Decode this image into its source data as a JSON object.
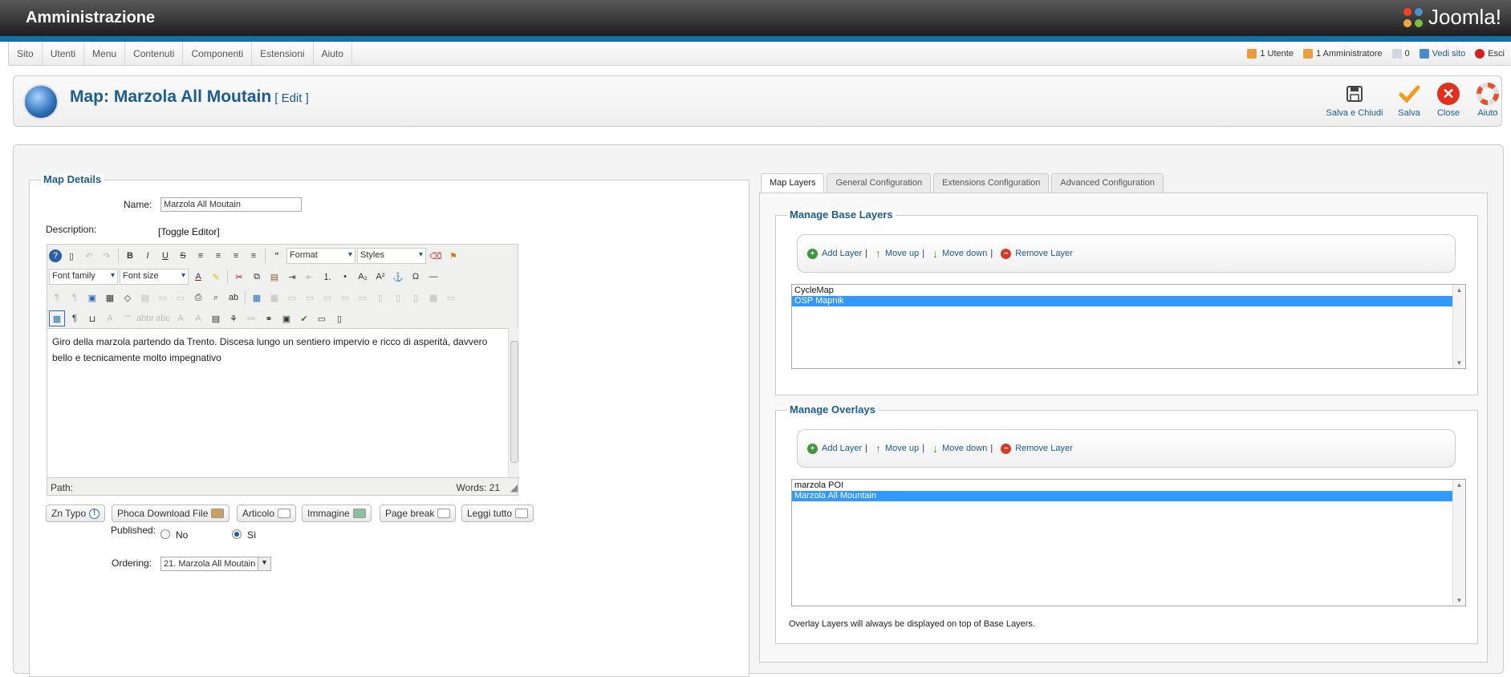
{
  "header": {
    "title": "Amministrazione",
    "logo_text": "Joomla!"
  },
  "menu": [
    "Sito",
    "Utenti",
    "Menu",
    "Contenuti",
    "Componenti",
    "Estensioni",
    "Aiuto"
  ],
  "status": {
    "users": "1 Utente",
    "admins": "1 Amministratore",
    "messages": "0",
    "view_site": "Vedi sito",
    "logout": "Esci"
  },
  "toolbar": {
    "page_title": "Map: Marzola All Moutain",
    "page_title_suffix": "[ Edit ]",
    "save_close": "Salva e Chiudi",
    "save": "Salva",
    "close": "Close",
    "help": "Aiuto"
  },
  "map_details": {
    "legend": "Map Details",
    "name_label": "Name:",
    "name_value": "Marzola All Moutain",
    "description_label": "Description:",
    "toggle_editor": "[Toggle Editor]",
    "editor": {
      "format_select": "Format",
      "styles_select": "Styles",
      "font_family_select": "Font family",
      "font_size_select": "Font size",
      "content": "Giro della marzola partendo da Trento. Discesa lungo un sentiero impervio e ricco di asperità, davvero bello e tecnicamente molto impegnativo",
      "path_label": "Path:",
      "words": "Words: 21"
    },
    "buttons": [
      "Zn Typo",
      "Phoca Download File",
      "Articolo",
      "Immagine",
      "Page break",
      "Leggi tutto"
    ],
    "published_label": "Published:",
    "published_no": "No",
    "published_yes": "Sì",
    "ordering_label": "Ordering:",
    "ordering_value": "21. Marzola All Moutain"
  },
  "tabs": [
    "Map Layers",
    "General Configuration",
    "Extensions Configuration",
    "Advanced Configuration"
  ],
  "base_layers": {
    "legend": "Manage Base Layers",
    "add": "Add Layer",
    "up": "Move up",
    "down": "Move down",
    "remove": "Remove Layer",
    "items": [
      "CycleMap",
      "OSP Mapnik"
    ],
    "selected_index": 1
  },
  "overlays": {
    "legend": "Manage Overlays",
    "add": "Add Layer",
    "up": "Move up",
    "down": "Move down",
    "remove": "Remove Layer",
    "items": [
      "marzola POI",
      "Marzola All Mountain"
    ],
    "selected_index": 1,
    "note": "Overlay Layers will always be displayed on top of Base Layers."
  }
}
